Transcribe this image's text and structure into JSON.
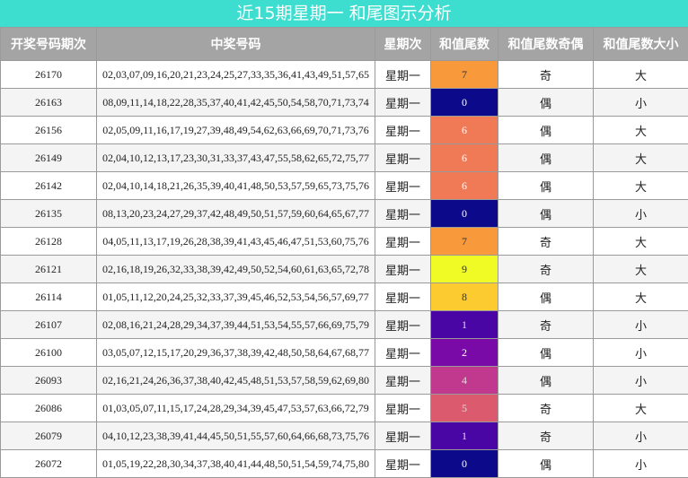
{
  "title": "近15期星期一 和尾图示分析",
  "headers": [
    "开奖号码期次",
    "中奖号码",
    "星期次",
    "和值尾数",
    "和值尾数奇偶",
    "和值尾数大小"
  ],
  "rows": [
    {
      "issue": "26170",
      "numbers": "02,03,07,09,16,20,21,23,24,25,27,33,35,36,41,43,49,51,57,65",
      "weekday": "星期一",
      "tail": "7",
      "parity": "奇",
      "size": "大",
      "color": "#f89a3c",
      "text_color": "#333333"
    },
    {
      "issue": "26163",
      "numbers": "08,09,11,14,18,22,28,35,37,40,41,42,45,50,54,58,70,71,73,74",
      "weekday": "星期一",
      "tail": "0",
      "parity": "偶",
      "size": "小",
      "color": "#0c0a8a",
      "text_color": "#ffffff"
    },
    {
      "issue": "26156",
      "numbers": "02,05,09,11,16,17,19,27,39,48,49,54,62,63,66,69,70,71,73,76",
      "weekday": "星期一",
      "tail": "6",
      "parity": "偶",
      "size": "大",
      "color": "#ef7a55",
      "text_color": "#ffffff"
    },
    {
      "issue": "26149",
      "numbers": "02,04,10,12,13,17,23,30,31,33,37,43,47,55,58,62,65,72,75,77",
      "weekday": "星期一",
      "tail": "6",
      "parity": "偶",
      "size": "大",
      "color": "#ef7a55",
      "text_color": "#ffffff"
    },
    {
      "issue": "26142",
      "numbers": "02,04,10,14,18,21,26,35,39,40,41,48,50,53,57,59,65,73,75,76",
      "weekday": "星期一",
      "tail": "6",
      "parity": "偶",
      "size": "大",
      "color": "#ef7a55",
      "text_color": "#ffffff"
    },
    {
      "issue": "26135",
      "numbers": "08,13,20,23,24,27,29,37,42,48,49,50,51,57,59,60,64,65,67,77",
      "weekday": "星期一",
      "tail": "0",
      "parity": "偶",
      "size": "小",
      "color": "#0c0a8a",
      "text_color": "#ffffff"
    },
    {
      "issue": "26128",
      "numbers": "04,05,11,13,17,19,26,28,38,39,41,43,45,46,47,51,53,60,75,76",
      "weekday": "星期一",
      "tail": "7",
      "parity": "奇",
      "size": "大",
      "color": "#f89a3c",
      "text_color": "#333333"
    },
    {
      "issue": "26121",
      "numbers": "02,16,18,19,26,32,33,38,39,42,49,50,52,54,60,61,63,65,72,78",
      "weekday": "星期一",
      "tail": "9",
      "parity": "奇",
      "size": "大",
      "color": "#f0fa24",
      "text_color": "#333333"
    },
    {
      "issue": "26114",
      "numbers": "01,05,11,12,20,24,25,32,33,37,39,45,46,52,53,54,56,57,69,77",
      "weekday": "星期一",
      "tail": "8",
      "parity": "偶",
      "size": "大",
      "color": "#fccb30",
      "text_color": "#333333"
    },
    {
      "issue": "26107",
      "numbers": "02,08,16,21,24,28,29,34,37,39,44,51,53,54,55,57,66,69,75,79",
      "weekday": "星期一",
      "tail": "1",
      "parity": "奇",
      "size": "小",
      "color": "#4a06a4",
      "text_color": "#dddddd"
    },
    {
      "issue": "26100",
      "numbers": "03,05,07,12,15,17,20,29,36,37,38,39,42,48,50,58,64,67,68,77",
      "weekday": "星期一",
      "tail": "2",
      "parity": "偶",
      "size": "小",
      "color": "#7a0aa8",
      "text_color": "#ffffff"
    },
    {
      "issue": "26093",
      "numbers": "02,16,21,24,26,36,37,38,40,42,45,48,51,53,57,58,59,62,69,80",
      "weekday": "星期一",
      "tail": "4",
      "parity": "偶",
      "size": "小",
      "color": "#c1398e",
      "text_color": "#dddddd"
    },
    {
      "issue": "26086",
      "numbers": "01,03,05,07,11,15,17,24,28,29,34,39,45,47,53,57,63,66,72,79",
      "weekday": "星期一",
      "tail": "5",
      "parity": "奇",
      "size": "大",
      "color": "#dc5a6e",
      "text_color": "#dddddd"
    },
    {
      "issue": "26079",
      "numbers": "04,10,12,23,38,39,41,44,45,50,51,55,57,60,64,66,68,73,75,76",
      "weekday": "星期一",
      "tail": "1",
      "parity": "奇",
      "size": "小",
      "color": "#4a06a4",
      "text_color": "#dddddd"
    },
    {
      "issue": "26072",
      "numbers": "01,05,19,22,28,30,34,37,38,40,41,44,48,50,51,54,59,74,75,80",
      "weekday": "星期一",
      "tail": "0",
      "parity": "偶",
      "size": "小",
      "color": "#0c0a8a",
      "text_color": "#ffffff"
    }
  ]
}
